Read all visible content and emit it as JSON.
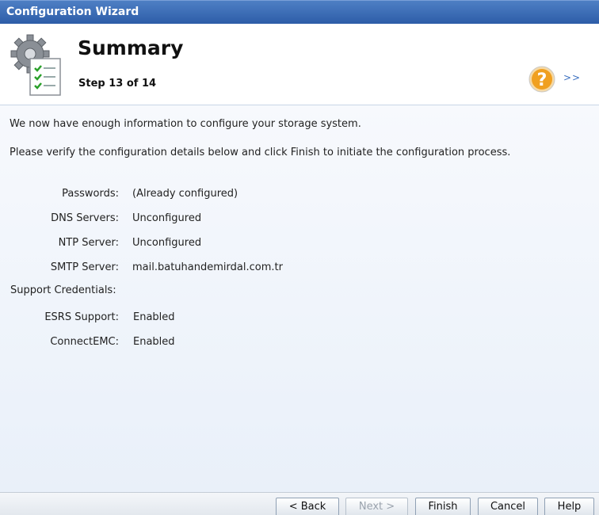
{
  "window": {
    "title": "Configuration Wizard"
  },
  "header": {
    "page_title": "Summary",
    "step": "Step 13 of 14",
    "expand_label": ">>"
  },
  "content": {
    "intro_line_1": "We now have enough information to configure your storage system.",
    "intro_line_2": "Please verify the configuration details below and click Finish to initiate the configuration process.",
    "details": [
      {
        "label": "Passwords:",
        "value": "(Already configured)"
      },
      {
        "label": "DNS Servers:",
        "value": "Unconfigured"
      },
      {
        "label": "NTP Server:",
        "value": "Unconfigured"
      },
      {
        "label": "SMTP Server:",
        "value": "mail.batuhandemirdal.com.tr"
      },
      {
        "label": "Support Credentials:",
        "value": ""
      },
      {
        "label": "ESRS Support:",
        "value": "Enabled"
      },
      {
        "label": "ConnectEMC:",
        "value": "Enabled"
      }
    ]
  },
  "footer": {
    "back_label": "< Back",
    "next_label": "Next >",
    "finish_label": "Finish",
    "cancel_label": "Cancel",
    "help_label": "Help"
  },
  "icons": {
    "wizard": "gear-checklist-icon",
    "help": "help-icon"
  },
  "colors": {
    "title_bar": "#2d5da8",
    "link": "#3a6fc0",
    "help_orange": "#f0a020"
  }
}
